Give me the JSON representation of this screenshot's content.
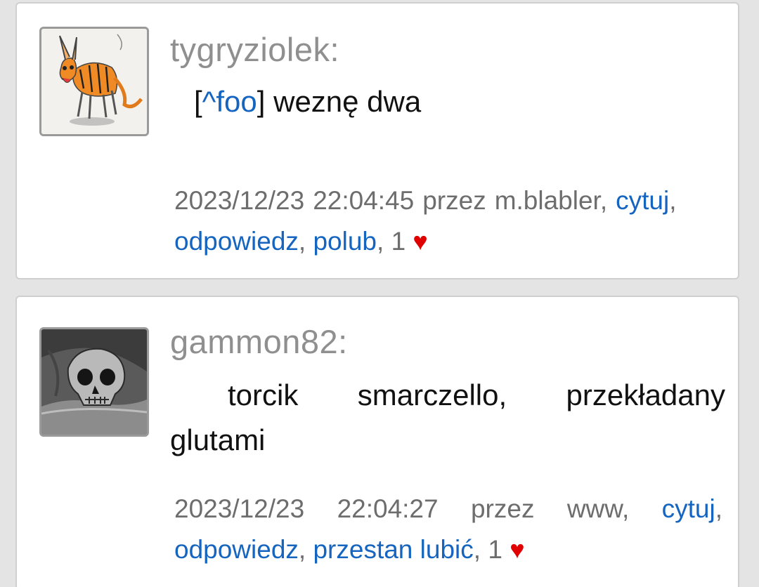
{
  "posts": [
    {
      "username": "tygryziolek:",
      "avatar_icon": "tiger-cartoon-avatar-icon",
      "message": {
        "open_bracket": "[",
        "ref_link": "^foo",
        "close_bracket": "]",
        "text": " weznę dwa"
      },
      "meta": {
        "date": "2023/12/23",
        "time": "22:04:45",
        "by_label": "przez",
        "author": "m.blabler,",
        "quote_label": "cytuj",
        "reply_label": "odpowiedz",
        "like_label": "polub",
        "like_count": "1",
        "heart": "♥"
      }
    },
    {
      "username": "gammon82:",
      "avatar_icon": "skull-photo-avatar-icon",
      "message": {
        "text": "torcik smarczello, przekładany glutami"
      },
      "meta": {
        "date": "2023/12/23",
        "time": "22:04:27",
        "by_label": "przez",
        "author": "www,",
        "quote_label": "cytuj",
        "reply_label": "odpowiedz",
        "like_label": "przestan lubić",
        "like_count": "1",
        "heart": "♥"
      }
    }
  ],
  "colors": {
    "background": "#e4e4e4",
    "card": "#ffffff",
    "link": "#1565c0",
    "username": "#8f8f8f",
    "meta_text": "#6d6d6d",
    "heart": "#e00000"
  }
}
